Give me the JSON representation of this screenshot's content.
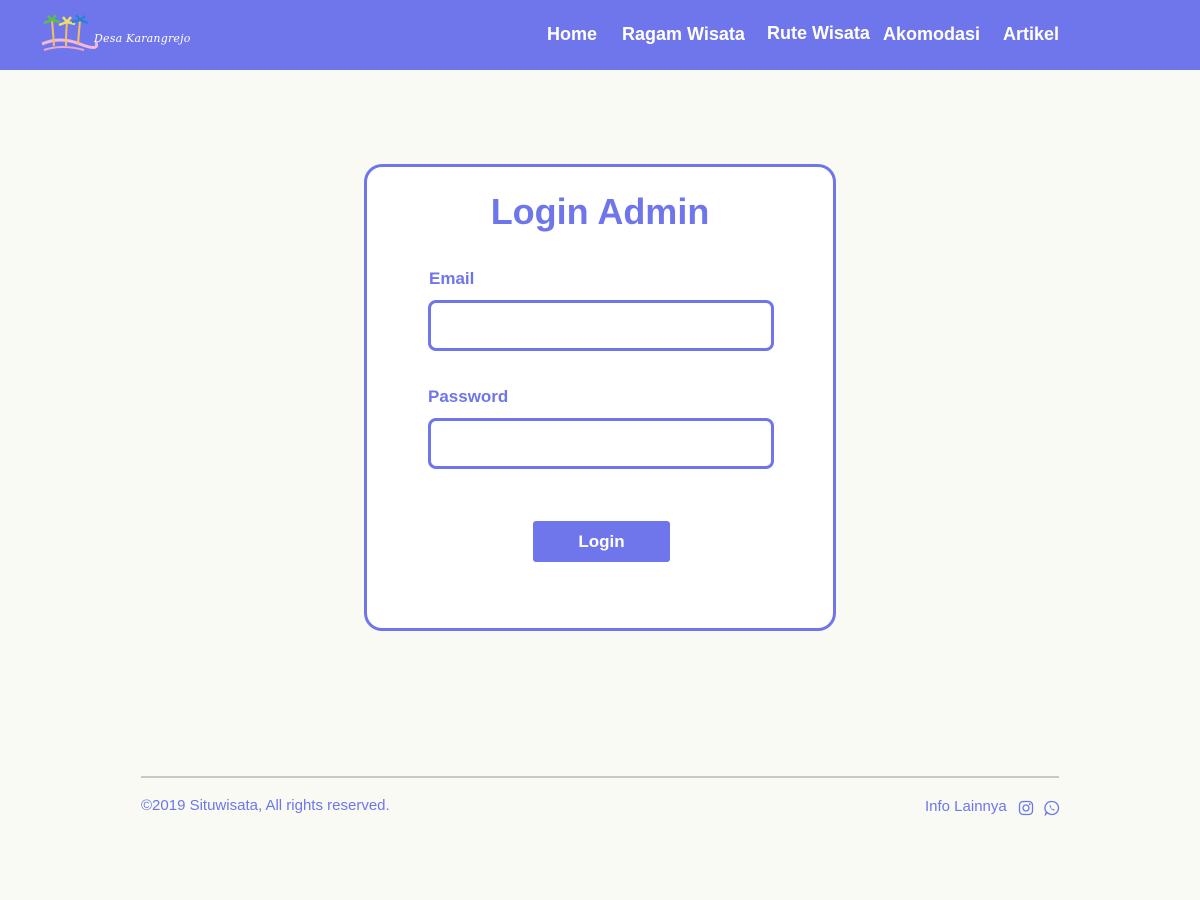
{
  "brand": {
    "logo_text": "Desa Karangrejo",
    "icon": "palm-tree-logo-icon"
  },
  "nav": {
    "items": [
      {
        "label": "Home"
      },
      {
        "label": "Ragam Wisata"
      },
      {
        "label": "Rute Wisata"
      },
      {
        "label": "Akomodasi"
      },
      {
        "label": "Artikel"
      }
    ]
  },
  "login": {
    "title": "Login Admin",
    "email_label": "Email",
    "email_value": "",
    "email_placeholder": "",
    "password_label": "Password",
    "password_value": "",
    "password_placeholder": "",
    "submit_label": "Login"
  },
  "footer": {
    "copyright": "©2019 Situwisata, All rights reserved.",
    "info_label": "Info Lainnya",
    "icons": [
      "instagram-icon",
      "whatsapp-icon"
    ]
  },
  "colors": {
    "primary": "#6f76ec",
    "background": "#f8faf3",
    "divider": "#c6cac6"
  }
}
